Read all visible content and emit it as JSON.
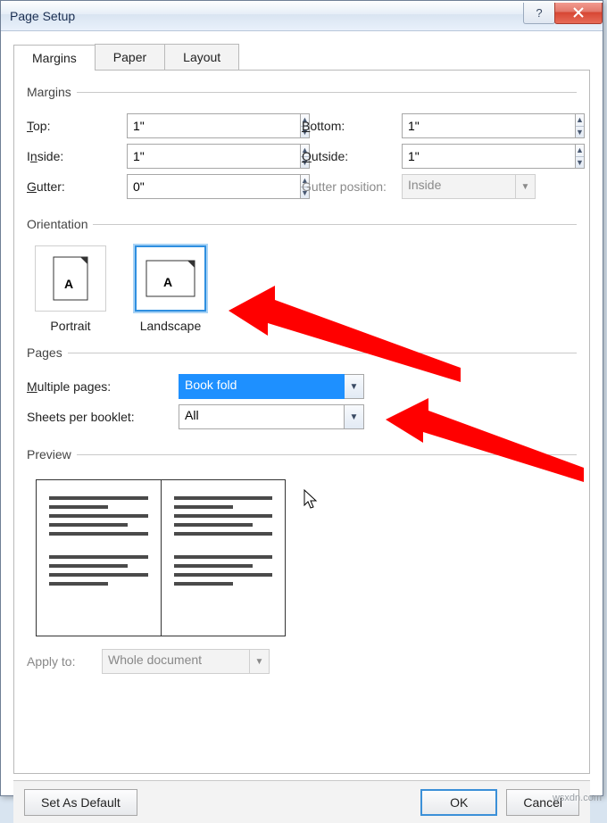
{
  "window": {
    "title": "Page Setup"
  },
  "tabs": {
    "margins": "Margins",
    "paper": "Paper",
    "layout": "Layout"
  },
  "sections": {
    "margins": "Margins",
    "orientation": "Orientation",
    "pages": "Pages",
    "preview": "Preview"
  },
  "margins": {
    "top_label": "Top:",
    "top_value": "1\"",
    "bottom_label": "Bottom:",
    "bottom_value": "1\"",
    "inside_label": "Inside:",
    "inside_value": "1\"",
    "outside_label": "Outside:",
    "outside_value": "1\"",
    "gutter_label": "Gutter:",
    "gutter_value": "0\"",
    "gutterpos_label": "Gutter position:",
    "gutterpos_value": "Inside"
  },
  "orientation": {
    "portrait": "Portrait",
    "landscape": "Landscape"
  },
  "pages": {
    "multiple_label": "Multiple pages:",
    "multiple_value": "Book fold",
    "sheets_label": "Sheets per booklet:",
    "sheets_value": "All"
  },
  "apply": {
    "label": "Apply to:",
    "value": "Whole document"
  },
  "footer": {
    "default": "Set As Default",
    "ok": "OK",
    "cancel": "Cancel"
  },
  "watermark": "wsxdn.com"
}
